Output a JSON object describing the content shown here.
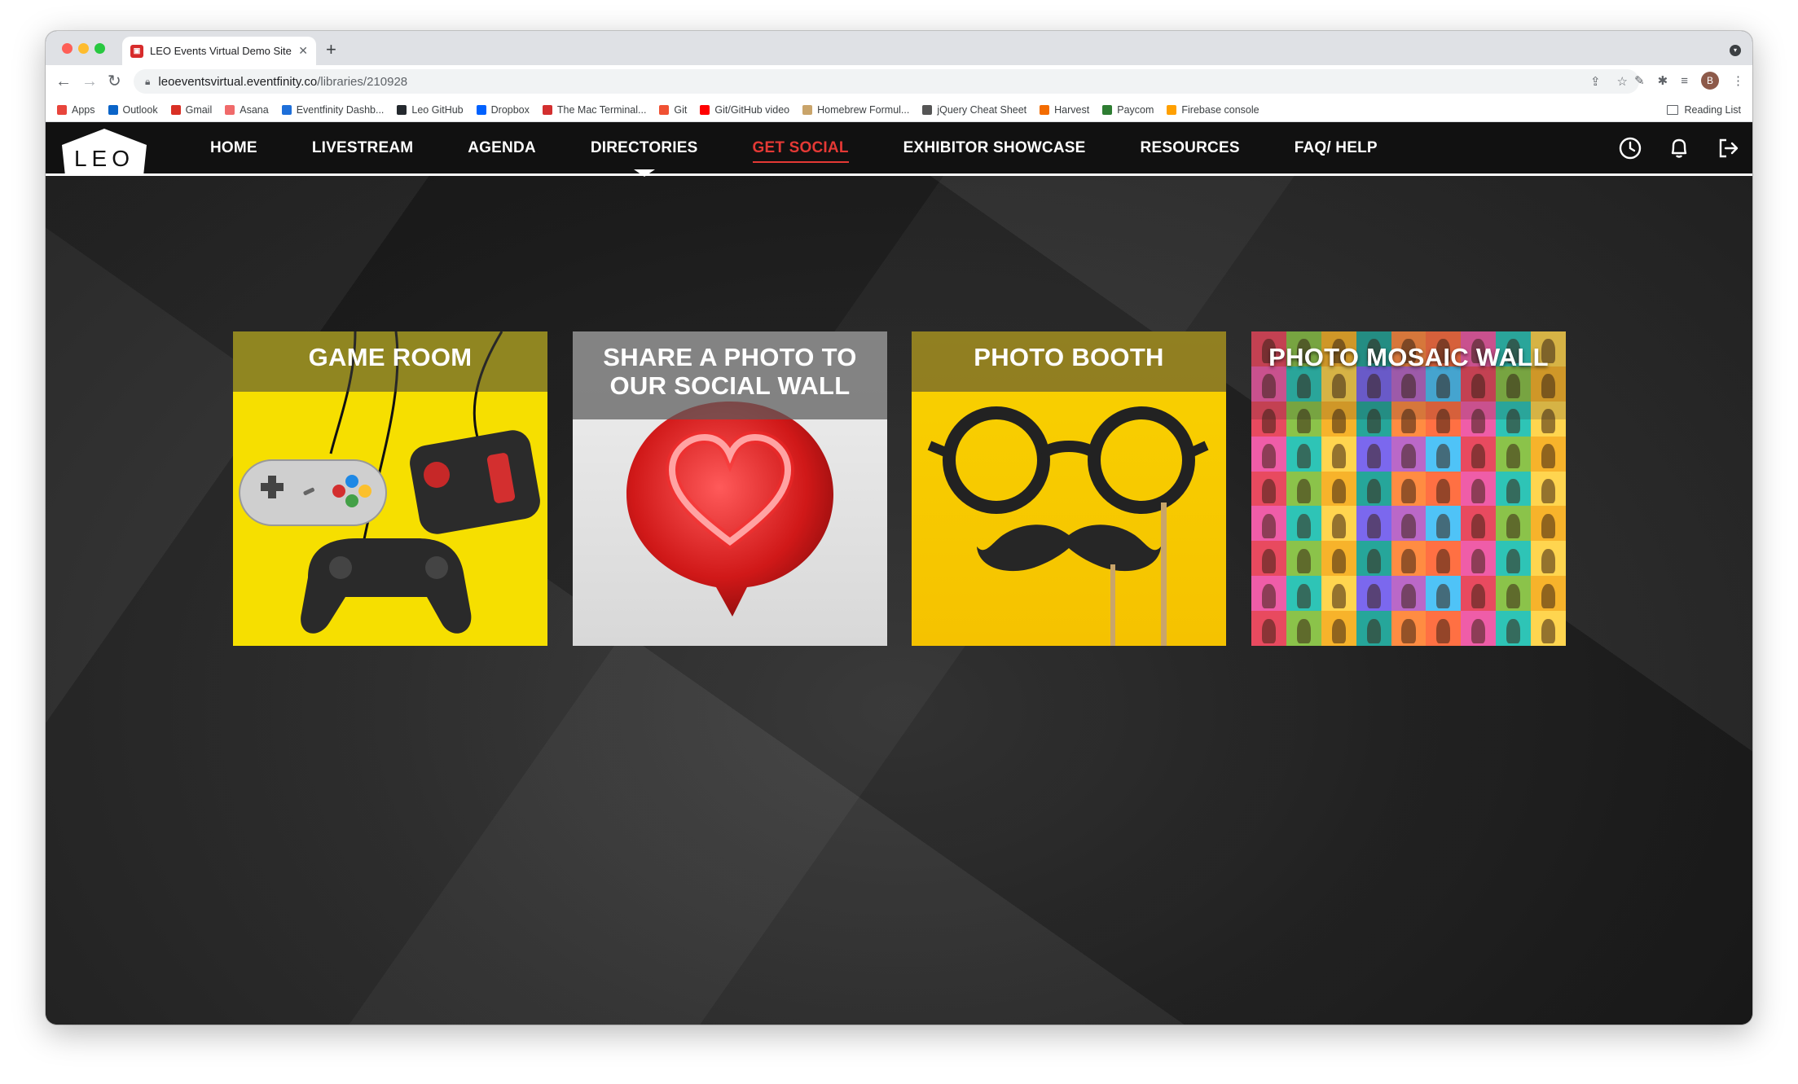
{
  "browser": {
    "tab_title": "LEO Events Virtual Demo Site",
    "new_tab_label": "+",
    "url_host": "leoeventsvirtual.eventfinity.co",
    "url_path": "/libraries/210928",
    "profile_initial": "B",
    "bookmarks": [
      {
        "label": "Apps",
        "icon": "apps-grid-icon",
        "color": "#e8453c"
      },
      {
        "label": "Outlook",
        "icon": "outlook-icon",
        "color": "#0a64c8"
      },
      {
        "label": "Gmail",
        "icon": "gmail-icon",
        "color": "#d93025"
      },
      {
        "label": "Asana",
        "icon": "asana-icon",
        "color": "#f06a6a"
      },
      {
        "label": "Eventfinity Dashb...",
        "icon": "eventfinity-icon",
        "color": "#1e6fd9"
      },
      {
        "label": "Leo GitHub",
        "icon": "github-icon",
        "color": "#24292e"
      },
      {
        "label": "Dropbox",
        "icon": "dropbox-icon",
        "color": "#0061fe"
      },
      {
        "label": "The Mac Terminal...",
        "icon": "terminal-icon",
        "color": "#d32f2f"
      },
      {
        "label": "Git",
        "icon": "git-icon",
        "color": "#f05133"
      },
      {
        "label": "Git/GitHub video",
        "icon": "youtube-icon",
        "color": "#ff0000"
      },
      {
        "label": "Homebrew Formul...",
        "icon": "homebrew-icon",
        "color": "#c9a46a"
      },
      {
        "label": "jQuery Cheat Sheet",
        "icon": "jquery-icon",
        "color": "#555555"
      },
      {
        "label": "Harvest",
        "icon": "harvest-icon",
        "color": "#f36c00"
      },
      {
        "label": "Paycom",
        "icon": "paycom-icon",
        "color": "#2e7d32"
      },
      {
        "label": "Firebase console",
        "icon": "firebase-icon",
        "color": "#ffa000"
      }
    ],
    "reading_list": "Reading List"
  },
  "site": {
    "logo_text": "LEO",
    "nav": [
      {
        "label": "HOME",
        "state": "normal"
      },
      {
        "label": "LIVESTREAM",
        "state": "normal"
      },
      {
        "label": "AGENDA",
        "state": "normal"
      },
      {
        "label": "DIRECTORIES",
        "state": "dropdown"
      },
      {
        "label": "GET SOCIAL",
        "state": "active"
      },
      {
        "label": "EXHIBITOR SHOWCASE",
        "state": "normal"
      },
      {
        "label": "RESOURCES",
        "state": "normal"
      },
      {
        "label": "FAQ/ HELP",
        "state": "normal"
      }
    ],
    "header_icons": [
      "clock-icon",
      "bell-icon",
      "logout-icon"
    ],
    "accent_color": "#e53935"
  },
  "tiles": [
    {
      "title": "GAME ROOM",
      "image": "game-controllers"
    },
    {
      "title": "SHARE A PHOTO TO OUR SOCIAL WALL",
      "image": "neon-heart"
    },
    {
      "title": "PHOTO BOOTH",
      "image": "glasses-mustache-props"
    },
    {
      "title": "PHOTO MOSAIC WALL",
      "image": "people-portrait-mosaic"
    }
  ]
}
